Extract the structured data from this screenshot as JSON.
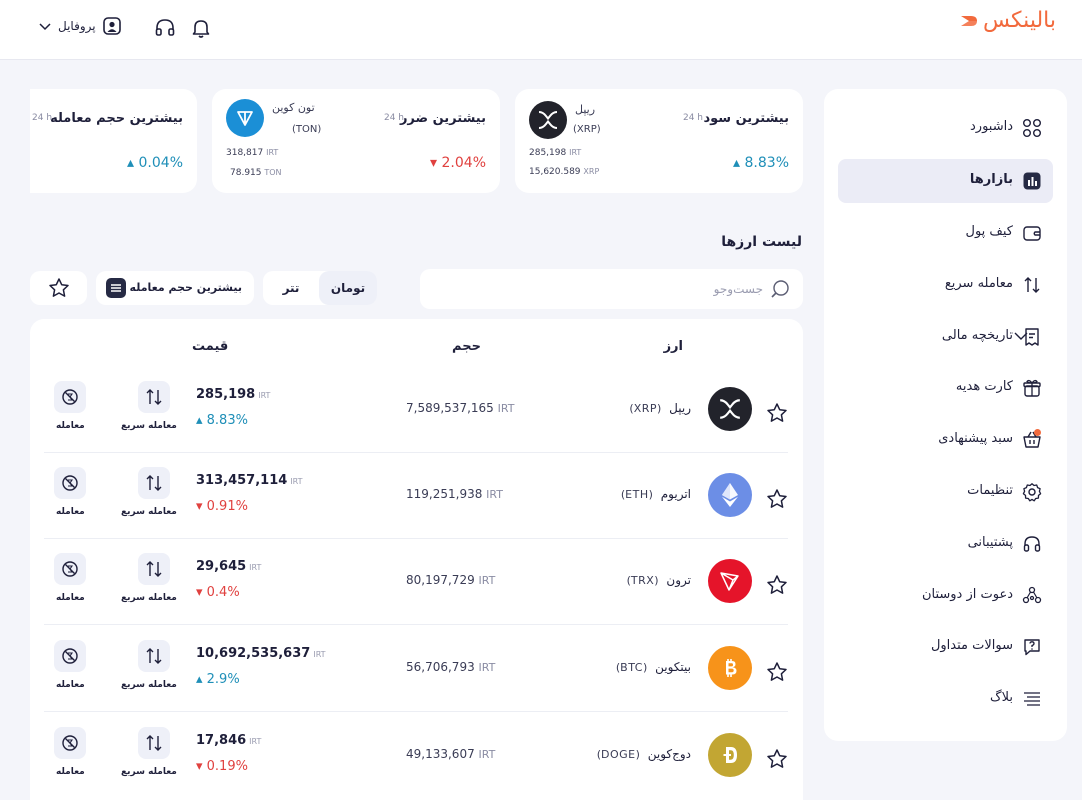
{
  "header": {
    "logo_text": "بالینکس",
    "profile_label": "پروفایل"
  },
  "sidebar": {
    "items": [
      {
        "label": "داشبورد"
      },
      {
        "label": "بازارها"
      },
      {
        "label": "کیف پول"
      },
      {
        "label": "معامله سریع"
      },
      {
        "label": "تاریخچه مالی"
      },
      {
        "label": "کارت هدیه"
      },
      {
        "label": "سبد پیشنهادی"
      },
      {
        "label": "تنظیمات"
      },
      {
        "label": "پشتیبانی"
      },
      {
        "label": "دعوت از دوستان"
      },
      {
        "label": "سوالات متداول"
      },
      {
        "label": "بلاگ"
      }
    ]
  },
  "cards": [
    {
      "title": "بیشترین سود",
      "period": "24 h",
      "change": "▴ 8.83%",
      "coin_name": "ریپل",
      "coin_symbol": "(XRP)",
      "price_value": "285,198",
      "price_unit": "IRT",
      "amount_value": "15,620.589",
      "amount_unit": "XRP"
    },
    {
      "title": "بیشترین ضرر",
      "period": "24 h",
      "change": "▾ 2.04%",
      "coin_name": "تون کوین",
      "coin_symbol": "(TON)",
      "price_value": "318,817",
      "price_unit": "IRT",
      "amount_value": "78.915",
      "amount_unit": "TON"
    },
    {
      "title": "بیشترین حجم معامله",
      "period": "24 h",
      "change": "▴ 0.04%"
    }
  ],
  "list": {
    "title": "لیست ارزها",
    "search_placeholder": "جست‌وجو",
    "quote_options": [
      "تومان",
      "تتر"
    ],
    "sort_label": "بیشترین حجم معامله",
    "columns": {
      "asset": "ارز",
      "volume": "حجم",
      "price": "قیمت"
    },
    "action_quick": "معامله سریع",
    "action_trade": "معامله",
    "rows": [
      {
        "name": "ریپل",
        "symbol": "(XRP)",
        "volume": "7,589,537,165",
        "volume_unit": "IRT",
        "price": "285,198",
        "price_unit": "IRT",
        "change": "▴ 8.83%",
        "direction": "up"
      },
      {
        "name": "اتریوم",
        "symbol": "(ETH)",
        "volume": "119,251,938",
        "volume_unit": "IRT",
        "price": "313,457,114",
        "price_unit": "IRT",
        "change": "▾ 0.91%",
        "direction": "down"
      },
      {
        "name": "ترون",
        "symbol": "(TRX)",
        "volume": "80,197,729",
        "volume_unit": "IRT",
        "price": "29,645",
        "price_unit": "IRT",
        "change": "▾ 0.4%",
        "direction": "down"
      },
      {
        "name": "بیتکوین",
        "symbol": "(BTC)",
        "volume": "56,706,793",
        "volume_unit": "IRT",
        "price": "10,692,535,637",
        "price_unit": "IRT",
        "change": "▴ 2.9%",
        "direction": "up"
      },
      {
        "name": "دوج‌کوین",
        "symbol": "(DOGE)",
        "volume": "49,133,607",
        "volume_unit": "IRT",
        "price": "17,846",
        "price_unit": "IRT",
        "change": "▾ 0.19%",
        "direction": "down"
      }
    ]
  },
  "colors": {
    "brand": "#f26a3d",
    "up": "#1f8fb8",
    "down": "#e0413f",
    "active_bg": "#ebecf6"
  }
}
